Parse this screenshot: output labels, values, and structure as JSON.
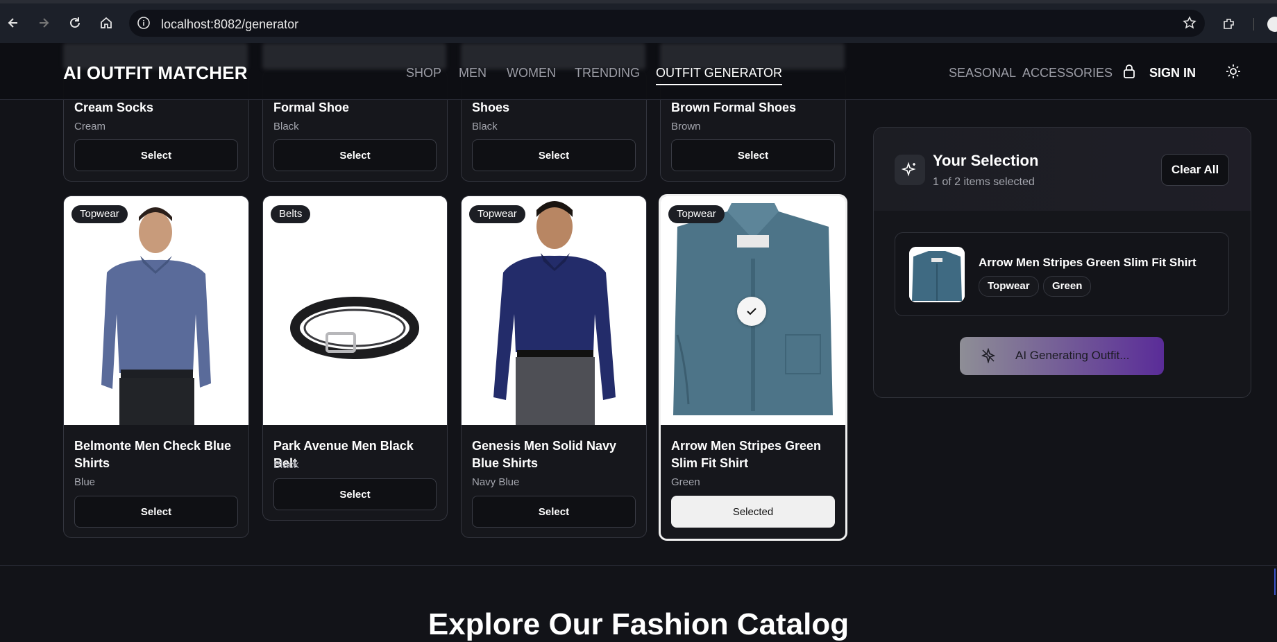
{
  "browser": {
    "url": "localhost:8082/generator",
    "icons": [
      "back-icon",
      "forward-icon",
      "reload-icon",
      "home-icon",
      "info-icon",
      "star-icon",
      "extensions-icon",
      "profile-icon"
    ]
  },
  "header": {
    "brand": "AI OUTFIT MATCHER",
    "nav": [
      "SHOP",
      "MEN",
      "WOMEN",
      "TRENDING",
      "OUTFIT GENERATOR"
    ],
    "active_nav": "OUTFIT GENERATOR",
    "right_nav": [
      "SEASONAL",
      "ACCESSORIES"
    ],
    "sign_in": "SIGN IN"
  },
  "top_row": [
    {
      "name": "Cream Socks",
      "color": "Cream",
      "button": "Select"
    },
    {
      "name": "Formal Shoe",
      "color": "Black",
      "button": "Select"
    },
    {
      "name": "Shoes",
      "color": "Black",
      "button": "Select"
    },
    {
      "name": "Brown Formal Shoes",
      "color": "Brown",
      "button": "Select"
    }
  ],
  "products": [
    {
      "category": "Topwear",
      "name": "Belmonte Men Check Blue Shirts",
      "color": "Blue",
      "button": "Select"
    },
    {
      "category": "Belts",
      "name": "Park Avenue Men Black Belt",
      "color": "Black",
      "button": "Select"
    },
    {
      "category": "Topwear",
      "name": "Genesis Men Solid Navy Blue Shirts",
      "color": "Navy Blue",
      "button": "Select"
    },
    {
      "category": "Topwear",
      "name": "Arrow Men Stripes Green Slim Fit Shirt",
      "color": "Green",
      "button": "Selected",
      "selected": true
    }
  ],
  "selection": {
    "title": "Your Selection",
    "subtitle": "1 of 2 items selected",
    "clear_label": "Clear All",
    "item": {
      "name": "Arrow Men Stripes Green Slim Fit Shirt",
      "category": "Topwear",
      "color": "Green"
    },
    "generate_label": "AI Generating Outfit..."
  },
  "catalog_heading": "Explore Our Fashion Catalog",
  "colors": {
    "background": "#121318",
    "card": "#16171c",
    "accent_gradient_end": "#5a2c98"
  }
}
